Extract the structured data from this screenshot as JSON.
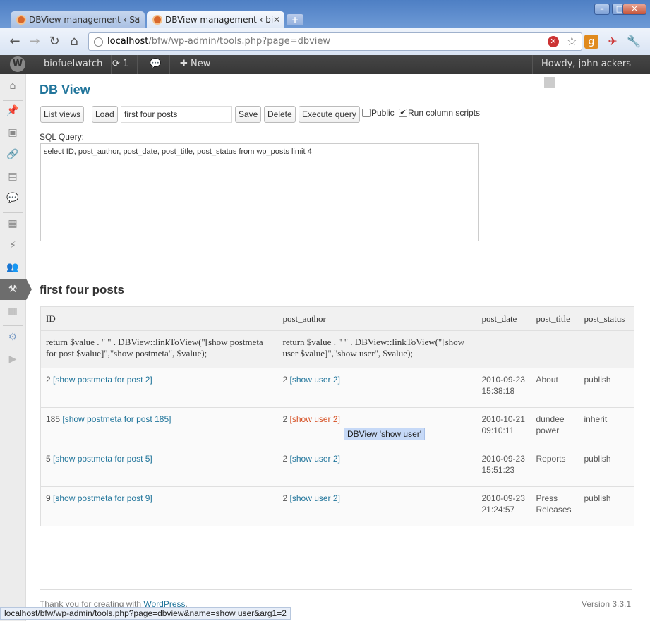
{
  "browser": {
    "tabs": [
      {
        "title": "DBView management ‹ Sa",
        "icon": "wordpress-favicon"
      },
      {
        "title": "DBView management ‹ bi",
        "icon": "wordpress-favicon"
      }
    ],
    "new_tab_label": "+",
    "url_host": "localhost",
    "url_path": "/bfw/wp-admin/tools.php?page=dbview",
    "window_buttons": [
      "–",
      "□",
      "✕"
    ]
  },
  "adminbar": {
    "site_name": "biofuelwatch",
    "updates_count": "1",
    "new_label": "New",
    "greeting": "Howdy, john ackers"
  },
  "page": {
    "title": "DB View",
    "buttons": {
      "list_views": "List views",
      "load": "Load",
      "save": "Save",
      "delete": "Delete",
      "execute": "Execute query"
    },
    "view_name": "first four posts",
    "public_label": "Public",
    "public_checked": false,
    "run_scripts_label": "Run column scripts",
    "run_scripts_checked": true,
    "sql_label": "SQL Query:",
    "sql_query": "select  ID, post_author, post_date, post_title, post_status from wp_posts limit 4",
    "section_title": "first four posts"
  },
  "table": {
    "columns": [
      "ID",
      "post_author",
      "post_date",
      "post_title",
      "post_status"
    ],
    "scripts": [
      "return $value . \" \" . DBView::linkToView(\"[show postmeta for post $value]\",\"show postmeta\", $value);",
      "return $value . \" \" . DBView::linkToView(\"[show user $value]\",\"show user\", $value);",
      "",
      "",
      ""
    ],
    "rows": [
      {
        "id": "2",
        "id_link": "[show postmeta for post 2]",
        "author": "2",
        "author_link": "[show user 2]",
        "date": "2010-09-23 15:38:18",
        "title": "About",
        "status": "publish"
      },
      {
        "id": "185",
        "id_link": "[show postmeta for post 185]",
        "author": "2",
        "author_link": "[show user 2]",
        "date": "2010-10-21 09:10:11",
        "title": "dundee power",
        "status": "inherit"
      },
      {
        "id": "5",
        "id_link": "[show postmeta for post 5]",
        "author": "2",
        "author_link": "[show user 2]",
        "date": "2010-09-23 15:51:23",
        "title": "Reports",
        "status": "publish"
      },
      {
        "id": "9",
        "id_link": "[show postmeta for post 9]",
        "author": "2",
        "author_link": "[show user 2]",
        "date": "2010-09-23 21:24:57",
        "title": "Press Releases",
        "status": "publish"
      }
    ]
  },
  "tooltip": "DBView 'show user'",
  "footer": {
    "thanks_prefix": "Thank you for creating with ",
    "wordpress_link": "WordPress",
    "thanks_suffix": ".",
    "version": "Version 3.3.1"
  },
  "statusbar": "localhost/bfw/wp-admin/tools.php?page=dbview&name=show user&arg1=2",
  "colors": {
    "link": "#21759b",
    "link_hover": "#d54e21",
    "adminbar": "#464646"
  }
}
